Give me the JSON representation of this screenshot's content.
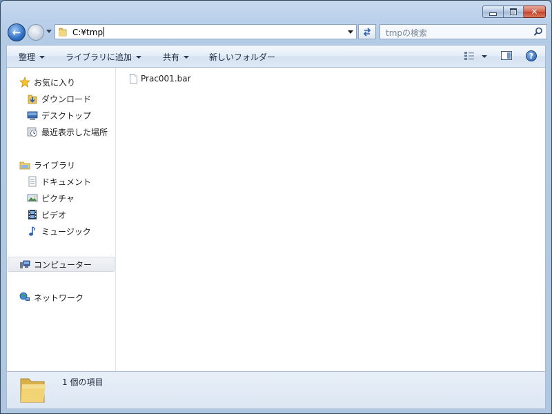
{
  "window": {
    "caption_min_icon": "minimize-icon",
    "caption_max_icon": "maximize-icon",
    "caption_close_icon": "close-icon"
  },
  "nav": {
    "back_icon": "back-arrow-icon",
    "forward_icon": "forward-arrow-icon",
    "address_path": "C:¥tmp",
    "search_placeholder": "tmpの検索"
  },
  "toolbar": {
    "organize": "整理",
    "add_to_library": "ライブラリに追加",
    "share": "共有",
    "new_folder": "新しいフォルダー"
  },
  "sidebar": {
    "favorites": {
      "label": "お気に入り",
      "items": [
        {
          "label": "ダウンロード"
        },
        {
          "label": "デスクトップ"
        },
        {
          "label": "最近表示した場所"
        }
      ]
    },
    "libraries": {
      "label": "ライブラリ",
      "items": [
        {
          "label": "ドキュメント"
        },
        {
          "label": "ピクチャ"
        },
        {
          "label": "ビデオ"
        },
        {
          "label": "ミュージック"
        }
      ]
    },
    "computer": {
      "label": "コンピューター"
    },
    "network": {
      "label": "ネットワーク"
    }
  },
  "files": [
    {
      "name": "Prac001.bar"
    }
  ],
  "details": {
    "item_count": "1 個の項目"
  },
  "colors": {
    "accent": "#2f6fc4",
    "window_frame": "#b4cbe6",
    "close_button": "#c4412a",
    "folder": "#e8c35a"
  }
}
